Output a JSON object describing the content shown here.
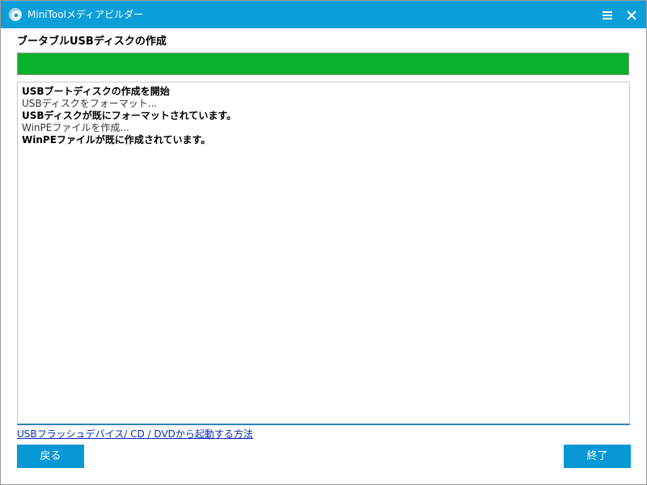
{
  "window": {
    "title": "MiniToolメディアビルダー"
  },
  "header": {
    "section_title": "ブータブルUSBディスクの作成"
  },
  "progress": {
    "value": 1.0,
    "color": "#08b02c"
  },
  "log": {
    "lines": [
      {
        "text": "USBブートディスクの作成を開始",
        "bold": true
      },
      {
        "text": "USBディスクをフォーマット...",
        "bold": false
      },
      {
        "text": "USBディスクが既にフォーマットされています。",
        "bold": true
      },
      {
        "text": "WinPEファイルを作成...",
        "bold": false
      },
      {
        "text": "WinPEファイルが既に作成されています。",
        "bold": true
      }
    ]
  },
  "links": {
    "help": "USBフラッシュデバイス/ CD / DVDから起動する方法"
  },
  "buttons": {
    "back": "戻る",
    "finish": "終了"
  },
  "colors": {
    "titlebar": "#0a9fd9",
    "button": "#0898d6",
    "link": "#0b2dbd"
  },
  "icons": {
    "app": "disc-icon",
    "menu": "hamburger-menu-icon",
    "close": "close-icon"
  }
}
